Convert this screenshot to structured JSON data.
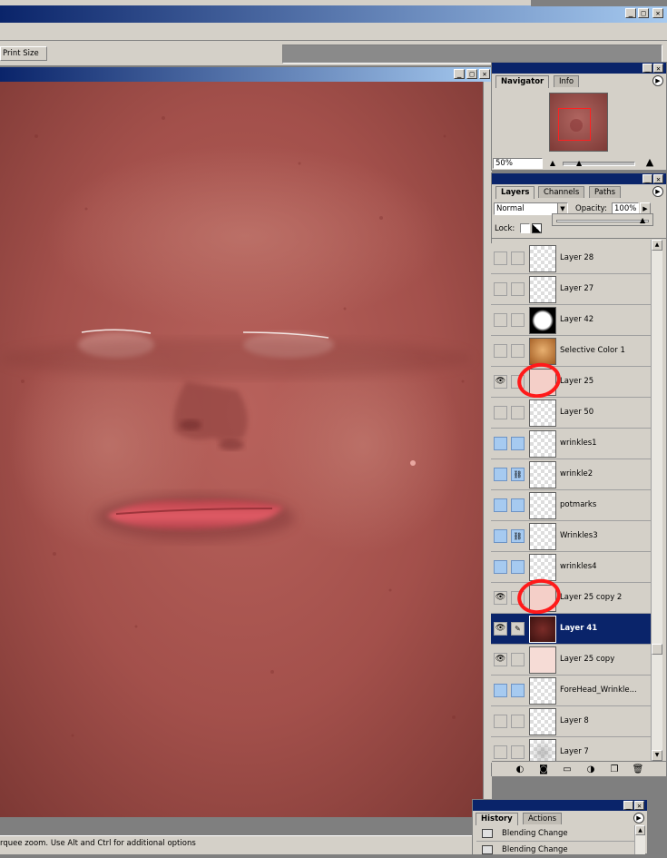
{
  "app": {
    "window_controls": [
      "_",
      "□",
      "✕"
    ]
  },
  "options_bar": {
    "print_size_label": "Print Size"
  },
  "document": {
    "window_controls": [
      "_",
      "□",
      "✕"
    ]
  },
  "status_bar": {
    "text": "rquee zoom.  Use Alt and Ctrl for additional options"
  },
  "navigator": {
    "tabs": [
      "Navigator",
      "Info"
    ],
    "zoom_value": "50%",
    "window_controls": [
      "_",
      "✕"
    ],
    "menu_icon": "flyout-arrow-icon"
  },
  "layers_panel": {
    "tabs": [
      "Layers",
      "Channels",
      "Paths"
    ],
    "blend_mode": "Normal",
    "opacity_label": "Opacity:",
    "opacity_value": "100%",
    "lock_label": "Lock:",
    "window_controls": [
      "_",
      "✕"
    ],
    "layers": [
      {
        "name": "Layer 28",
        "visible": false,
        "linked": false,
        "highlight": false,
        "thumb": "transparent"
      },
      {
        "name": "Layer 27",
        "visible": false,
        "linked": false,
        "highlight": false,
        "thumb": "transparent"
      },
      {
        "name": "Layer 42",
        "visible": false,
        "linked": false,
        "highlight": false,
        "thumb": "mask-blob"
      },
      {
        "name": "Selective Color 1",
        "visible": false,
        "linked": false,
        "highlight": false,
        "thumb": "face-orange"
      },
      {
        "name": "Layer 25",
        "visible": true,
        "linked": false,
        "highlight": false,
        "thumb": "pink",
        "circled": true
      },
      {
        "name": "Layer 50",
        "visible": false,
        "linked": false,
        "highlight": false,
        "thumb": "transparent"
      },
      {
        "name": "wrinkles1",
        "visible": false,
        "linked": false,
        "highlight": true,
        "thumb": "transparent"
      },
      {
        "name": "wrinkle2",
        "visible": false,
        "linked": true,
        "highlight": true,
        "thumb": "transparent"
      },
      {
        "name": "potmarks",
        "visible": false,
        "linked": false,
        "highlight": true,
        "thumb": "transparent"
      },
      {
        "name": "Wrinkles3",
        "visible": false,
        "linked": true,
        "highlight": true,
        "thumb": "transparent"
      },
      {
        "name": "wrinkles4",
        "visible": false,
        "linked": false,
        "highlight": true,
        "thumb": "transparent"
      },
      {
        "name": "Layer 25 copy 2",
        "visible": true,
        "linked": false,
        "highlight": false,
        "thumb": "pink",
        "circled": true
      },
      {
        "name": "Layer 41",
        "visible": true,
        "linked": false,
        "highlight": false,
        "thumb": "dark-red",
        "selected": true
      },
      {
        "name": "Layer 25 copy",
        "visible": true,
        "linked": false,
        "highlight": false,
        "thumb": "light-pink"
      },
      {
        "name": "ForeHead_Wrinkle...",
        "visible": false,
        "linked": false,
        "highlight": true,
        "thumb": "transparent"
      },
      {
        "name": "Layer 8",
        "visible": false,
        "linked": false,
        "highlight": false,
        "thumb": "transparent"
      },
      {
        "name": "Layer 7",
        "visible": false,
        "linked": false,
        "highlight": false,
        "thumb": "transparent-gray"
      }
    ],
    "bottom_icons": [
      "layer-style-icon",
      "mask-icon",
      "folder-icon",
      "adjustment-layer-icon",
      "new-layer-icon",
      "trash-icon"
    ]
  },
  "history_panel": {
    "tabs": [
      "History",
      "Actions"
    ],
    "window_controls": [
      "_",
      "✕"
    ],
    "items": [
      "Blending Change",
      "Blending Change"
    ]
  },
  "colors": {
    "title_dark": "#0a246a",
    "title_light": "#a6caf0",
    "selection": "#0a246a",
    "highlight_blue": "#a6caf0",
    "annotation_red": "#ff1a1a",
    "skin": "#a04a46"
  }
}
